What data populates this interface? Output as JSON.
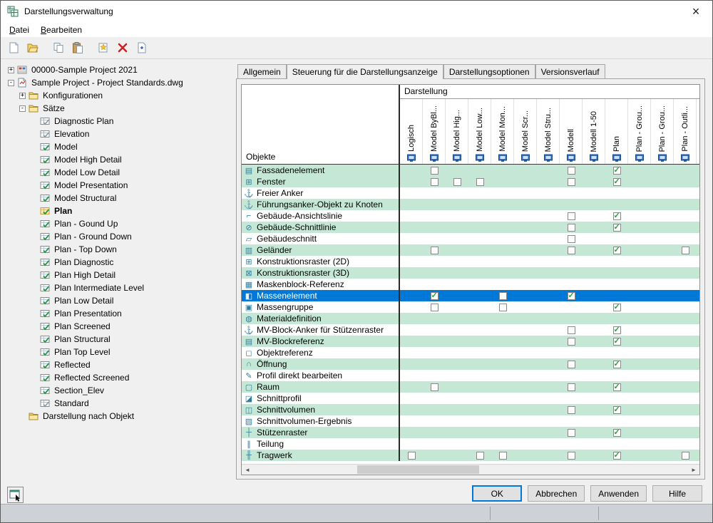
{
  "window": {
    "title": "Darstellungsverwaltung",
    "close_glyph": "×"
  },
  "menu": {
    "items": [
      {
        "name": "menu-datei",
        "label": "Datei"
      },
      {
        "name": "menu-bearbeiten",
        "label": "Bearbeiten"
      }
    ]
  },
  "toolbar": {
    "buttons": [
      {
        "name": "new-button",
        "icon": "new-file"
      },
      {
        "name": "open-button",
        "icon": "open-folder"
      },
      {
        "name": "copy-button",
        "icon": "copy"
      },
      {
        "name": "paste-button",
        "icon": "paste"
      },
      {
        "name": "new-set-button",
        "icon": "new-item"
      },
      {
        "name": "delete-button",
        "icon": "delete"
      },
      {
        "name": "purge-button",
        "icon": "purge"
      }
    ]
  },
  "tree": {
    "nodes": [
      {
        "depth": 0,
        "expander": "+",
        "icon": "project",
        "label": "00000-Sample Project 2021",
        "bold": false
      },
      {
        "depth": 0,
        "expander": "-",
        "icon": "dwg",
        "label": "Sample Project - Project Standards.dwg",
        "bold": false
      },
      {
        "depth": 1,
        "expander": "+",
        "icon": "folder",
        "label": "Konfigurationen",
        "bold": false
      },
      {
        "depth": 1,
        "expander": "-",
        "icon": "folder",
        "label": "Sätze",
        "bold": false
      },
      {
        "depth": 2,
        "expander": "",
        "icon": "set-gray",
        "label": "Diagnostic Plan",
        "bold": false
      },
      {
        "depth": 2,
        "expander": "",
        "icon": "set-gray",
        "label": "Elevation",
        "bold": false
      },
      {
        "depth": 2,
        "expander": "",
        "icon": "set",
        "label": "Model",
        "bold": false
      },
      {
        "depth": 2,
        "expander": "",
        "icon": "set",
        "label": "Model High Detail",
        "bold": false
      },
      {
        "depth": 2,
        "expander": "",
        "icon": "set",
        "label": "Model Low Detail",
        "bold": false
      },
      {
        "depth": 2,
        "expander": "",
        "icon": "set",
        "label": "Model Presentation",
        "bold": false
      },
      {
        "depth": 2,
        "expander": "",
        "icon": "set",
        "label": "Model Structural",
        "bold": false
      },
      {
        "depth": 2,
        "expander": "",
        "icon": "set-active",
        "label": "Plan",
        "bold": true
      },
      {
        "depth": 2,
        "expander": "",
        "icon": "set",
        "label": "Plan - Gound Up",
        "bold": false
      },
      {
        "depth": 2,
        "expander": "",
        "icon": "set",
        "label": "Plan - Ground Down",
        "bold": false
      },
      {
        "depth": 2,
        "expander": "",
        "icon": "set",
        "label": "Plan - Top Down",
        "bold": false
      },
      {
        "depth": 2,
        "expander": "",
        "icon": "set",
        "label": "Plan Diagnostic",
        "bold": false
      },
      {
        "depth": 2,
        "expander": "",
        "icon": "set",
        "label": "Plan High Detail",
        "bold": false
      },
      {
        "depth": 2,
        "expander": "",
        "icon": "set",
        "label": "Plan Intermediate Level",
        "bold": false
      },
      {
        "depth": 2,
        "expander": "",
        "icon": "set",
        "label": "Plan Low Detail",
        "bold": false
      },
      {
        "depth": 2,
        "expander": "",
        "icon": "set",
        "label": "Plan Presentation",
        "bold": false
      },
      {
        "depth": 2,
        "expander": "",
        "icon": "set",
        "label": "Plan Screened",
        "bold": false
      },
      {
        "depth": 2,
        "expander": "",
        "icon": "set",
        "label": "Plan Structural",
        "bold": false
      },
      {
        "depth": 2,
        "expander": "",
        "icon": "set",
        "label": "Plan Top Level",
        "bold": false
      },
      {
        "depth": 2,
        "expander": "",
        "icon": "set",
        "label": "Reflected",
        "bold": false
      },
      {
        "depth": 2,
        "expander": "",
        "icon": "set",
        "label": "Reflected Screened",
        "bold": false
      },
      {
        "depth": 2,
        "expander": "",
        "icon": "set",
        "label": "Section_Elev",
        "bold": false
      },
      {
        "depth": 2,
        "expander": "",
        "icon": "set-gray",
        "label": "Standard",
        "bold": false
      },
      {
        "depth": 1,
        "expander": "",
        "icon": "folder",
        "label": "Darstellung nach Objekt",
        "bold": false
      }
    ]
  },
  "tabs": {
    "items": [
      {
        "name": "tab-allgemein",
        "label": "Allgemein",
        "active": false
      },
      {
        "name": "tab-steuerung-darstellungsanzeige",
        "label": "Steuerung für die Darstellungsanzeige",
        "active": true
      },
      {
        "name": "tab-darstellungsoptionen",
        "label": "Darstellungsoptionen",
        "active": false
      },
      {
        "name": "tab-versionsverlauf",
        "label": "Versionsverlauf",
        "active": false
      }
    ]
  },
  "table": {
    "group_header": "Darstellung",
    "objects_header": "Objekte",
    "columns": [
      {
        "label": "Logisch"
      },
      {
        "label": "Model ByBl..."
      },
      {
        "label": "Model Hig..."
      },
      {
        "label": "Model Low..."
      },
      {
        "label": "Model Mon..."
      },
      {
        "label": "Model Scr..."
      },
      {
        "label": "Model Stru..."
      },
      {
        "label": "Modell"
      },
      {
        "label": "Modell 1-50"
      },
      {
        "label": "Plan"
      },
      {
        "label": "Plan - Grou..."
      },
      {
        "label": "Plan - Grou..."
      },
      {
        "label": "Plan - Outli..."
      }
    ],
    "rows": [
      {
        "label": "Fassadenelement",
        "glyph": "▤",
        "tint": true,
        "selected": false,
        "cells": [
          "",
          "u",
          "",
          "",
          "",
          "",
          "",
          "u",
          "",
          "c",
          "",
          "",
          ""
        ]
      },
      {
        "label": "Fenster",
        "glyph": "⊞",
        "tint": true,
        "selected": false,
        "cells": [
          "",
          "u",
          "u",
          "u",
          "",
          "",
          "",
          "u",
          "",
          "c",
          "",
          "",
          ""
        ]
      },
      {
        "label": "Freier Anker",
        "glyph": "⚓",
        "tint": false,
        "selected": false,
        "cells": [
          "",
          "",
          "",
          "",
          "",
          "",
          "",
          "",
          "",
          "",
          "",
          "",
          ""
        ]
      },
      {
        "label": "Führungsanker-Objekt zu Knoten",
        "glyph": "⚓",
        "tint": true,
        "selected": false,
        "cells": [
          "",
          "",
          "",
          "",
          "",
          "",
          "",
          "",
          "",
          "",
          "",
          "",
          ""
        ]
      },
      {
        "label": "Gebäude-Ansichtslinie",
        "glyph": "⌐",
        "tint": false,
        "selected": false,
        "cells": [
          "",
          "",
          "",
          "",
          "",
          "",
          "",
          "u",
          "",
          "c",
          "",
          "",
          ""
        ]
      },
      {
        "label": "Gebäude-Schnittlinie",
        "glyph": "⊘",
        "tint": true,
        "selected": false,
        "cells": [
          "",
          "",
          "",
          "",
          "",
          "",
          "",
          "u",
          "",
          "c",
          "",
          "",
          ""
        ]
      },
      {
        "label": "Gebäudeschnitt",
        "glyph": "▱",
        "tint": false,
        "selected": false,
        "cells": [
          "",
          "",
          "",
          "",
          "",
          "",
          "",
          "u",
          "",
          "",
          "",
          "",
          ""
        ]
      },
      {
        "label": "Geländer",
        "glyph": "▥",
        "tint": true,
        "selected": false,
        "cells": [
          "",
          "u",
          "",
          "",
          "",
          "",
          "",
          "u",
          "",
          "c",
          "",
          "",
          "u"
        ]
      },
      {
        "label": "Konstruktionsraster (2D)",
        "glyph": "⊞",
        "tint": false,
        "selected": false,
        "cells": [
          "",
          "",
          "",
          "",
          "",
          "",
          "",
          "",
          "",
          "",
          "",
          "",
          ""
        ]
      },
      {
        "label": "Konstruktionsraster (3D)",
        "glyph": "⊠",
        "tint": true,
        "selected": false,
        "cells": [
          "",
          "",
          "",
          "",
          "",
          "",
          "",
          "",
          "",
          "",
          "",
          "",
          ""
        ]
      },
      {
        "label": "Maskenblock-Referenz",
        "glyph": "▦",
        "tint": false,
        "selected": false,
        "cells": [
          "",
          "",
          "",
          "",
          "",
          "",
          "",
          "",
          "",
          "",
          "",
          "",
          ""
        ]
      },
      {
        "label": "Massenelement",
        "glyph": "◧",
        "tint": false,
        "selected": true,
        "cells": [
          "",
          "c",
          "",
          "",
          "u",
          "",
          "",
          "c",
          "",
          "",
          "",
          "",
          ""
        ]
      },
      {
        "label": "Massengruppe",
        "glyph": "▣",
        "tint": false,
        "selected": false,
        "cells": [
          "",
          "u",
          "",
          "",
          "u",
          "",
          "",
          "",
          "",
          "c",
          "",
          "",
          ""
        ]
      },
      {
        "label": "Materialdefinition",
        "glyph": "◍",
        "tint": true,
        "selected": false,
        "cells": [
          "",
          "",
          "",
          "",
          "",
          "",
          "",
          "",
          "",
          "",
          "",
          "",
          ""
        ]
      },
      {
        "label": "MV-Block-Anker für Stützenraster",
        "glyph": "⚓",
        "tint": false,
        "selected": false,
        "cells": [
          "",
          "",
          "",
          "",
          "",
          "",
          "",
          "u",
          "",
          "c",
          "",
          "",
          ""
        ]
      },
      {
        "label": "MV-Blockreferenz",
        "glyph": "▤",
        "tint": true,
        "selected": false,
        "cells": [
          "",
          "",
          "",
          "",
          "",
          "",
          "",
          "u",
          "",
          "c",
          "",
          "",
          ""
        ]
      },
      {
        "label": "Objektreferenz",
        "glyph": "◻",
        "tint": false,
        "selected": false,
        "cells": [
          "",
          "",
          "",
          "",
          "",
          "",
          "",
          "",
          "",
          "",
          "",
          "",
          ""
        ]
      },
      {
        "label": "Öffnung",
        "glyph": "∩",
        "tint": true,
        "selected": false,
        "cells": [
          "",
          "",
          "",
          "",
          "",
          "",
          "",
          "u",
          "",
          "c",
          "",
          "",
          ""
        ]
      },
      {
        "label": "Profil direkt bearbeiten",
        "glyph": "✎",
        "tint": false,
        "selected": false,
        "cells": [
          "",
          "",
          "",
          "",
          "",
          "",
          "",
          "",
          "",
          "",
          "",
          "",
          ""
        ]
      },
      {
        "label": "Raum",
        "glyph": "▢",
        "tint": true,
        "selected": false,
        "cells": [
          "",
          "u",
          "",
          "",
          "",
          "",
          "",
          "u",
          "",
          "c",
          "",
          "",
          ""
        ]
      },
      {
        "label": "Schnittprofil",
        "glyph": "◪",
        "tint": false,
        "selected": false,
        "cells": [
          "",
          "",
          "",
          "",
          "",
          "",
          "",
          "",
          "",
          "",
          "",
          "",
          ""
        ]
      },
      {
        "label": "Schnittvolumen",
        "glyph": "◫",
        "tint": true,
        "selected": false,
        "cells": [
          "",
          "",
          "",
          "",
          "",
          "",
          "",
          "u",
          "",
          "c",
          "",
          "",
          ""
        ]
      },
      {
        "label": "Schnittvolumen-Ergebnis",
        "glyph": "▨",
        "tint": false,
        "selected": false,
        "cells": [
          "",
          "",
          "",
          "",
          "",
          "",
          "",
          "",
          "",
          "",
          "",
          "",
          ""
        ]
      },
      {
        "label": "Stützenraster",
        "glyph": "┼",
        "tint": true,
        "selected": false,
        "cells": [
          "",
          "",
          "",
          "",
          "",
          "",
          "",
          "u",
          "",
          "c",
          "",
          "",
          ""
        ]
      },
      {
        "label": "Teilung",
        "glyph": "∥",
        "tint": false,
        "selected": false,
        "cells": [
          "",
          "",
          "",
          "",
          "",
          "",
          "",
          "",
          "",
          "",
          "",
          "",
          ""
        ]
      },
      {
        "label": "Tragwerk",
        "glyph": "╫",
        "tint": true,
        "selected": false,
        "cells": [
          "u",
          "",
          "",
          "u",
          "u",
          "",
          "",
          "u",
          "",
          "c",
          "",
          "",
          "u"
        ]
      }
    ]
  },
  "scrollbar": {
    "left_glyph": "◄",
    "right_glyph": "►",
    "thumb_left": "24%",
    "thumb_width": "28%"
  },
  "buttons": {
    "items": [
      {
        "name": "ok-button",
        "label": "OK",
        "default": true
      },
      {
        "name": "cancel-button",
        "label": "Abbrechen",
        "default": false
      },
      {
        "name": "apply-button",
        "label": "Anwenden",
        "default": false
      },
      {
        "name": "help-button",
        "label": "Hilfe",
        "default": false
      }
    ]
  },
  "colors": {
    "selection": "#0078d7",
    "row_tint": "#c5e8d6",
    "check_green": "#2d9f45"
  }
}
